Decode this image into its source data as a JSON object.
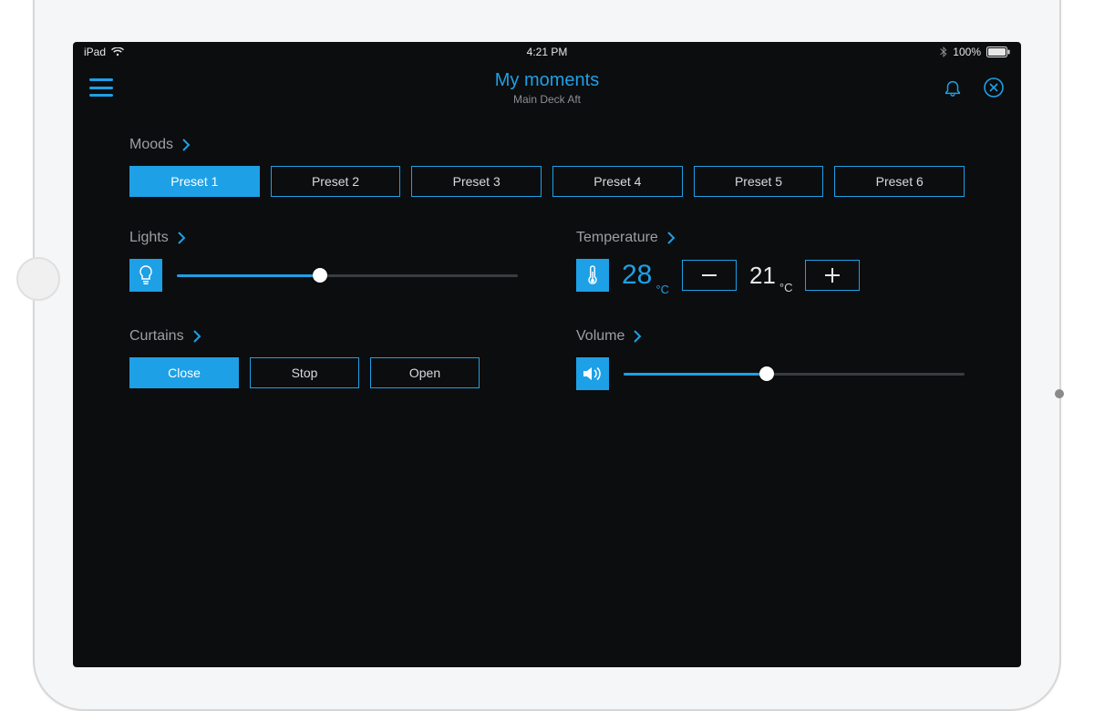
{
  "status_bar": {
    "device": "iPad",
    "time": "4:21 PM",
    "battery": "100%"
  },
  "header": {
    "title": "My moments",
    "subtitle": "Main Deck Aft"
  },
  "moods": {
    "label": "Moods",
    "presets": [
      {
        "label": "Preset 1",
        "active": true
      },
      {
        "label": "Preset 2",
        "active": false
      },
      {
        "label": "Preset 3",
        "active": false
      },
      {
        "label": "Preset 4",
        "active": false
      },
      {
        "label": "Preset 5",
        "active": false
      },
      {
        "label": "Preset 6",
        "active": false
      }
    ]
  },
  "lights": {
    "label": "Lights",
    "value_percent": 42
  },
  "curtains": {
    "label": "Curtains",
    "buttons": [
      {
        "label": "Close",
        "active": true
      },
      {
        "label": "Stop",
        "active": false
      },
      {
        "label": "Open",
        "active": false
      }
    ]
  },
  "temperature": {
    "label": "Temperature",
    "current": "28",
    "current_unit": "°C",
    "setpoint": "21",
    "setpoint_unit": "°C"
  },
  "volume": {
    "label": "Volume",
    "value_percent": 42
  },
  "colors": {
    "accent": "#1ea0e6",
    "bg": "#0c0d0f",
    "muted": "#9aa0a4"
  }
}
